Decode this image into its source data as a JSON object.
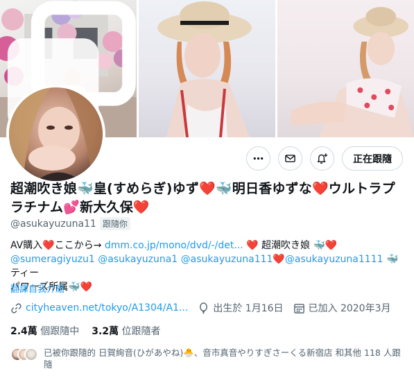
{
  "profile": {
    "name": "超潮吹き娘🐳皇(すめらぎ)ゆず❤️🐳明日香ゆずな❤️ウルトラプラチナム💕新大久保❤️",
    "handle": "@asukayuzuna11",
    "follows_you": "跟隨你",
    "bio": {
      "line1_prefix": "AV購入❤️ここから→ ",
      "line1_link": "dmm.co.jp/mono/dvd/-/det...",
      "line1_suffix": " ❤️ 超潮吹き娘 🐳❤️",
      "mention1": "@sumeragiyuzu1",
      "mention2": "@asukayuzuna1",
      "mention3": "@asukayuzuna111",
      "mention4": "@asukayuzuna1111",
      "line2_suffix": " 🐳ティー",
      "line3": "パワーズ所属🐳❤️"
    },
    "translate": "翻譯自我介紹",
    "website": "cityheaven.net/tokyo/A1304/A1...",
    "birthday": "出生於 1月16日",
    "joined": "已加入 2020年3月",
    "following_count": "2.4萬",
    "following_label": "個跟隨中",
    "followers_count": "3.2萬",
    "followers_label": "位跟隨者",
    "known_followers": "已被你跟隨的 日賀絢音(ひがあやね)🐣、音市真音やりすぎさーくる新宿店 和其他 118 人跟隨"
  },
  "buttons": {
    "more": "more-icon",
    "message": "mail-icon",
    "notify": "bell-plus-icon",
    "following": "正在跟隨"
  },
  "colors": {
    "accent": "#1d9bf0",
    "secondary_text": "#536471",
    "primary_text": "#0f1419",
    "border": "#cfd9de"
  }
}
